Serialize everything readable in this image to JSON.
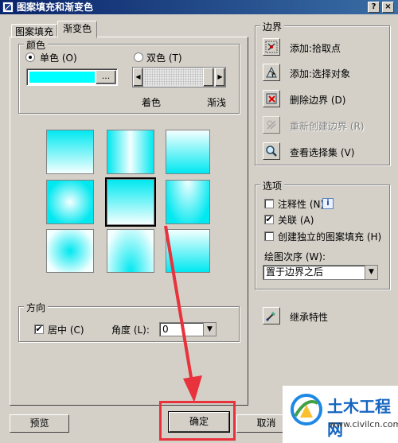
{
  "window": {
    "title": "图案填充和渐变色",
    "help_label": "?",
    "close_label": "×"
  },
  "tabs": [
    {
      "label": "图案填充"
    },
    {
      "label": "渐变色"
    }
  ],
  "color_group": {
    "title": "颜色",
    "single_label": "单色 (O)",
    "double_label": "双色 (T)",
    "browse_label": "...",
    "shade_label": "着色",
    "tint_label": "渐浅",
    "selected": "single",
    "gradient_color": "#00ffff",
    "shade_level": 0.97
  },
  "direction_group": {
    "title": "方向",
    "centered_label": "居中 (C)",
    "centered_checked": true,
    "angle_label": "角度 (L):",
    "angle_value": "0"
  },
  "boundary_group": {
    "title": "边界",
    "items": [
      {
        "label": "添加:拾取点",
        "icon": "pick-points-icon",
        "enabled": true
      },
      {
        "label": "添加:选择对象",
        "icon": "select-objects-icon",
        "enabled": true
      },
      {
        "label": "删除边界 (D)",
        "icon": "remove-boundary-icon",
        "enabled": true
      },
      {
        "label": "重新创建边界 (R)",
        "icon": "recreate-boundary-icon",
        "enabled": false
      },
      {
        "label": "查看选择集 (V)",
        "icon": "view-selection-icon",
        "enabled": true
      }
    ]
  },
  "options_group": {
    "title": "选项",
    "annotative_label": "注释性 (N)",
    "annotative_checked": false,
    "associative_label": "关联 (A)",
    "associative_checked": true,
    "separate_label": "创建独立的图案填充 (H)",
    "separate_checked": false,
    "draw_order_label": "绘图次序 (W):",
    "draw_order_value": "置于边界之后"
  },
  "inherit_label": "继承特性",
  "buttons": {
    "preview": "预览",
    "ok": "确定",
    "cancel": "取消"
  },
  "watermark": {
    "brand": "土木工程网",
    "url": "www.civilcn.com"
  },
  "annotation": {
    "highlight_color": "#e8323c"
  }
}
